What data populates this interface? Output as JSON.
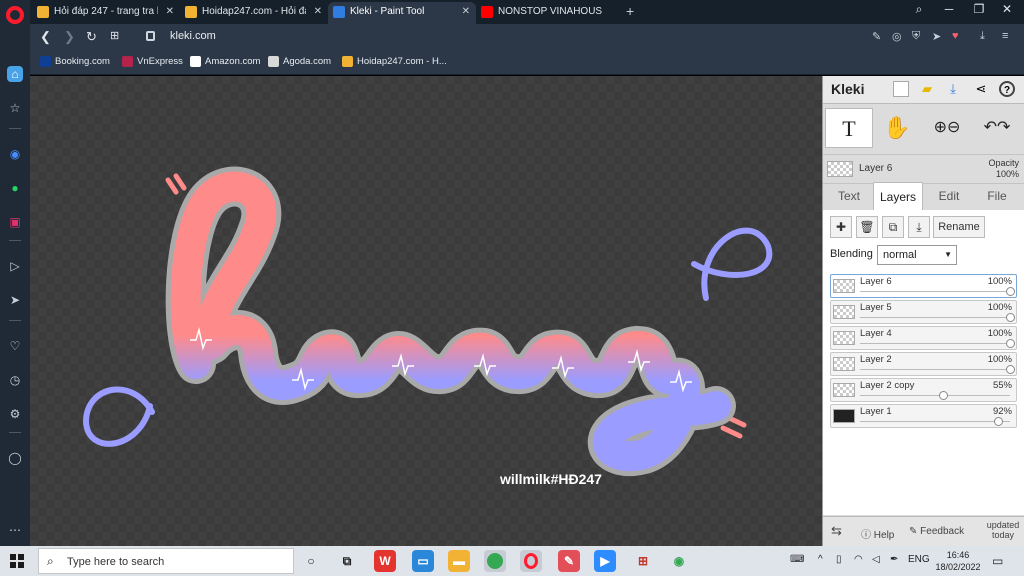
{
  "browser": {
    "tabs": [
      {
        "title": "Hỏi đáp 247 - trang tra lời",
        "favicon_color": "#f2b233",
        "active": false
      },
      {
        "title": "Hoidap247.com - Hỏi đáp",
        "favicon_color": "#f2b233",
        "active": false
      },
      {
        "title": "Kleki - Paint Tool",
        "favicon_color": "#2f7de1",
        "active": true
      },
      {
        "title": "NONSTOP VINAHOUSE",
        "favicon_color": "#ff0000",
        "active": false
      }
    ],
    "url": "kleki.com",
    "bookmarks": [
      {
        "label": "Booking.com",
        "color": "#0f3f94"
      },
      {
        "label": "VnExpress",
        "color": "#b4234b"
      },
      {
        "label": "Amazon.com",
        "color": "#222222"
      },
      {
        "label": "Agoda.com",
        "color": "#ffffff"
      },
      {
        "label": "Hoidap247.com - H...",
        "color": "#f2b233"
      }
    ]
  },
  "canvas": {
    "watermark": "willmilk#HĐ247",
    "colors": {
      "background": "#3b3b3b",
      "pink": "#ff8a8a",
      "lilac": "#9b9cff",
      "outline": "#a9a9a9"
    }
  },
  "kleki": {
    "logo": "Kleki",
    "active_layer": "Layer 6",
    "opacity_label": "Opacity",
    "opacity_value": "100%",
    "tabs": [
      "Text",
      "Layers",
      "Edit",
      "File"
    ],
    "selected_tab": "Layers",
    "rename_label": "Rename",
    "blending_label": "Blending",
    "blending_value": "normal",
    "layers": [
      {
        "name": "Layer 6",
        "opacity": "100%",
        "fraction": 1.0,
        "selected": true,
        "thumb": "checker"
      },
      {
        "name": "Layer 5",
        "opacity": "100%",
        "fraction": 1.0,
        "selected": false,
        "thumb": "checker"
      },
      {
        "name": "Layer 4",
        "opacity": "100%",
        "fraction": 1.0,
        "selected": false,
        "thumb": "checker"
      },
      {
        "name": "Layer 2",
        "opacity": "100%",
        "fraction": 1.0,
        "selected": false,
        "thumb": "checker"
      },
      {
        "name": "Layer 2 copy",
        "opacity": "55%",
        "fraction": 0.55,
        "selected": false,
        "thumb": "checker"
      },
      {
        "name": "Layer 1",
        "opacity": "92%",
        "fraction": 0.92,
        "selected": false,
        "thumb": "dark"
      }
    ],
    "footer": {
      "help": "Help",
      "feedback": "Feedback",
      "updated": "updated today"
    }
  },
  "taskbar": {
    "search_placeholder": "Type here to search",
    "language": "ENG",
    "time": "16:46",
    "date": "18/02/2022"
  }
}
